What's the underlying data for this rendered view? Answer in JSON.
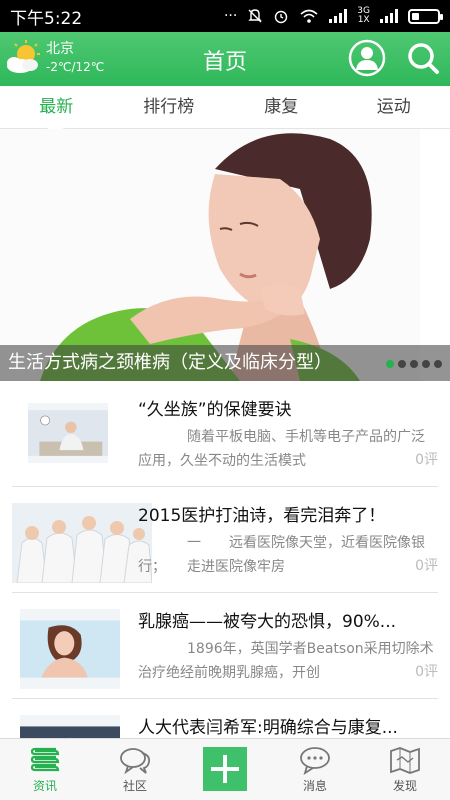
{
  "statusbar": {
    "time": "下午5:22",
    "network_top": "3G",
    "network_bottom": "1X"
  },
  "header": {
    "city": "北京",
    "temperature": "-2℃/12℃",
    "title": "首页"
  },
  "tabs": [
    {
      "label": "最新",
      "active": true
    },
    {
      "label": "排行榜",
      "active": false
    },
    {
      "label": "康复",
      "active": false
    },
    {
      "label": "运动",
      "active": false
    }
  ],
  "banner": {
    "caption": "生活方式病之颈椎病（定义及临床分型）",
    "slide_count": 5,
    "active_slide": 1
  },
  "news": [
    {
      "title": "“久坐族”的保健要诀",
      "summary": "随着平板电脑、手机等电子产品的广泛应用，久坐不动的生活模式",
      "count": "0评"
    },
    {
      "title": "2015医护打油诗，看完泪奔了！",
      "summary": "一　　远看医院像天堂，近看医院像银行；　　走进医院像牢房",
      "count": "0评"
    },
    {
      "title": "乳腺癌——被夸大的恐惧，90%...",
      "summary": "1896年，英国学者Beatson采用切除术治疗绝经前晚期乳腺癌，开创",
      "count": "0评"
    },
    {
      "title": "人大代表闫希军:明确综合与康复...",
      "summary": "",
      "count": ""
    }
  ],
  "bottomnav": [
    {
      "label": "资讯",
      "icon": "books-icon",
      "active": true
    },
    {
      "label": "社区",
      "icon": "chat-bubble-icon",
      "active": false
    },
    {
      "label": "",
      "icon": "plus-icon",
      "active": false
    },
    {
      "label": "消息",
      "icon": "message-icon",
      "active": false
    },
    {
      "label": "发现",
      "icon": "map-icon",
      "active": false
    }
  ],
  "colors": {
    "accent": "#27b04f",
    "header_green": "#3fc06a"
  }
}
